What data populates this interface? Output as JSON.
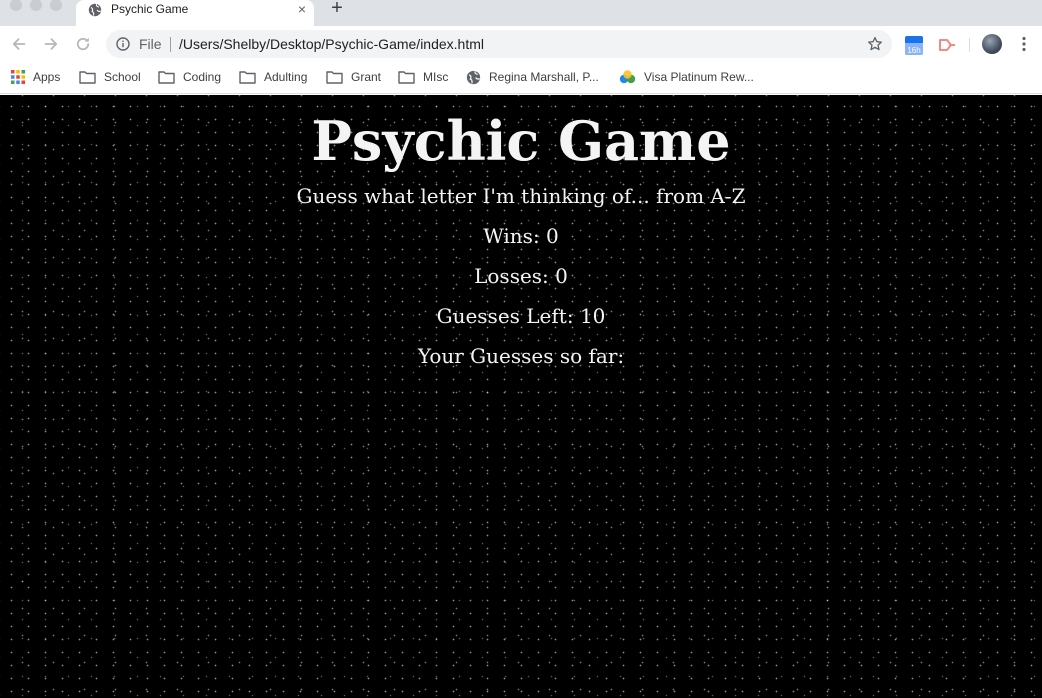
{
  "browser": {
    "tab": {
      "title": "Psychic Game",
      "close_glyph": "×"
    },
    "new_tab_glyph": "+",
    "omnibox": {
      "scheme": "File",
      "url": "/Users/Shelby/Desktop/Psychic-Game/index.html"
    },
    "extensions": {
      "calendar_badge": "16h"
    },
    "bookmarks": [
      {
        "label": "Apps",
        "icon": "apps-grid-icon"
      },
      {
        "label": "School",
        "icon": "folder-icon"
      },
      {
        "label": "Coding",
        "icon": "folder-icon"
      },
      {
        "label": "Adulting",
        "icon": "folder-icon"
      },
      {
        "label": "Grant",
        "icon": "folder-icon"
      },
      {
        "label": "MIsc",
        "icon": "folder-icon"
      },
      {
        "label": "Regina Marshall, P...",
        "icon": "globe-icon"
      },
      {
        "label": "Visa Platinum Rew...",
        "icon": "visa-logo-icon"
      }
    ]
  },
  "game": {
    "title": "Psychic Game",
    "prompt": "Guess what letter I'm thinking of... from A-Z",
    "wins_label": "Wins:",
    "wins_value": "0",
    "losses_label": "Losses:",
    "losses_value": "0",
    "guesses_left_label": "Guesses Left:",
    "guesses_left_value": "10",
    "guesses_so_far_label": "Your Guesses so far:",
    "guesses_so_far_value": ""
  },
  "colors": {
    "page_background": "#000000",
    "page_text": "#f4f4f4",
    "tab_strip": "#dee1e6",
    "omnibox": "#f1f3f4"
  }
}
